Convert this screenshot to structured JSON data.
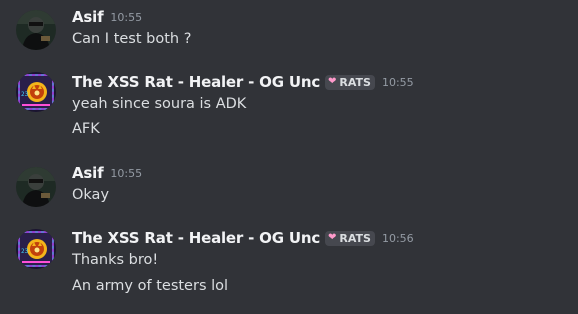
{
  "messages": [
    {
      "author": "Asif",
      "avatar_icon": "dark-figure-avatar",
      "timestamp": "10:55",
      "tag": null,
      "lines": [
        "Can I test both ?"
      ]
    },
    {
      "author": "The XSS Rat - Healer - OG Unc",
      "avatar_icon": "rat-badge-avatar",
      "timestamp": "10:55",
      "tag": {
        "icon": "pink-heart-icon",
        "label": "RATS"
      },
      "lines": [
        "yeah since soura is ADK",
        "AFK"
      ]
    },
    {
      "author": "Asif",
      "avatar_icon": "dark-figure-avatar",
      "timestamp": "10:55",
      "tag": null,
      "lines": [
        "Okay"
      ]
    },
    {
      "author": "The XSS Rat - Healer - OG Unc",
      "avatar_icon": "rat-badge-avatar",
      "timestamp": "10:56",
      "tag": {
        "icon": "pink-heart-icon",
        "label": "RATS"
      },
      "lines": [
        "Thanks bro!",
        "An army of testers lol"
      ]
    }
  ],
  "colors": {
    "background": "#313338",
    "username": "#f2f3f5",
    "timestamp": "#949ba4",
    "message_text": "#dbdee1",
    "tag_background": "#46484f",
    "heart": "#ff9acb"
  }
}
